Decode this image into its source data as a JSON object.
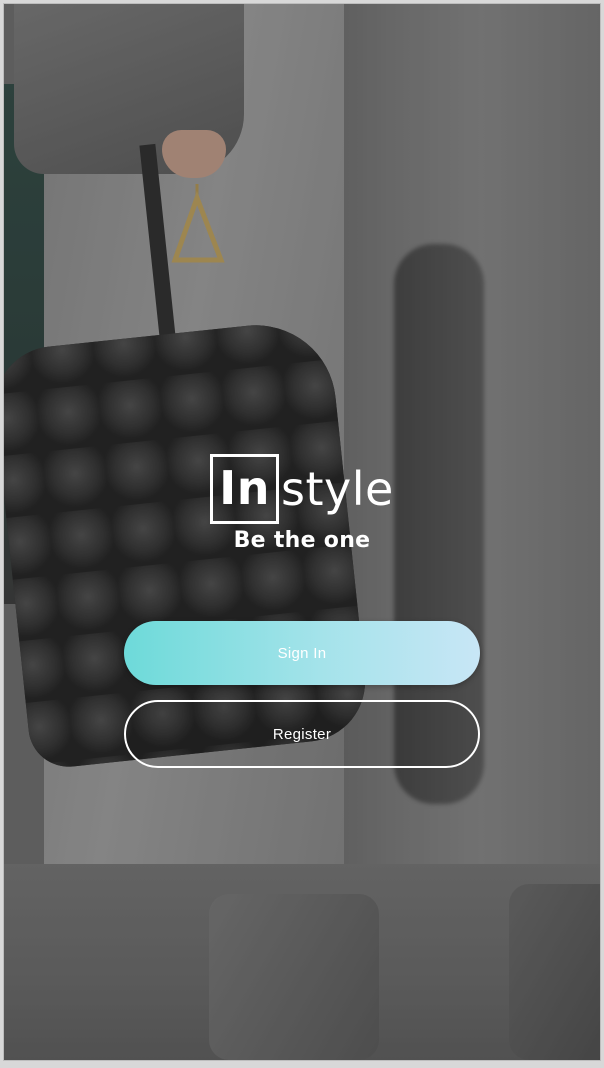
{
  "brand": {
    "boxed_part": "In",
    "rest": "style",
    "tagline": "Be the one"
  },
  "actions": {
    "sign_in_label": "Sign In",
    "register_label": "Register"
  },
  "colors": {
    "sign_in_gradient_start": "#6ddad9",
    "sign_in_gradient_end": "#c8e6f6",
    "text": "#ffffff"
  }
}
